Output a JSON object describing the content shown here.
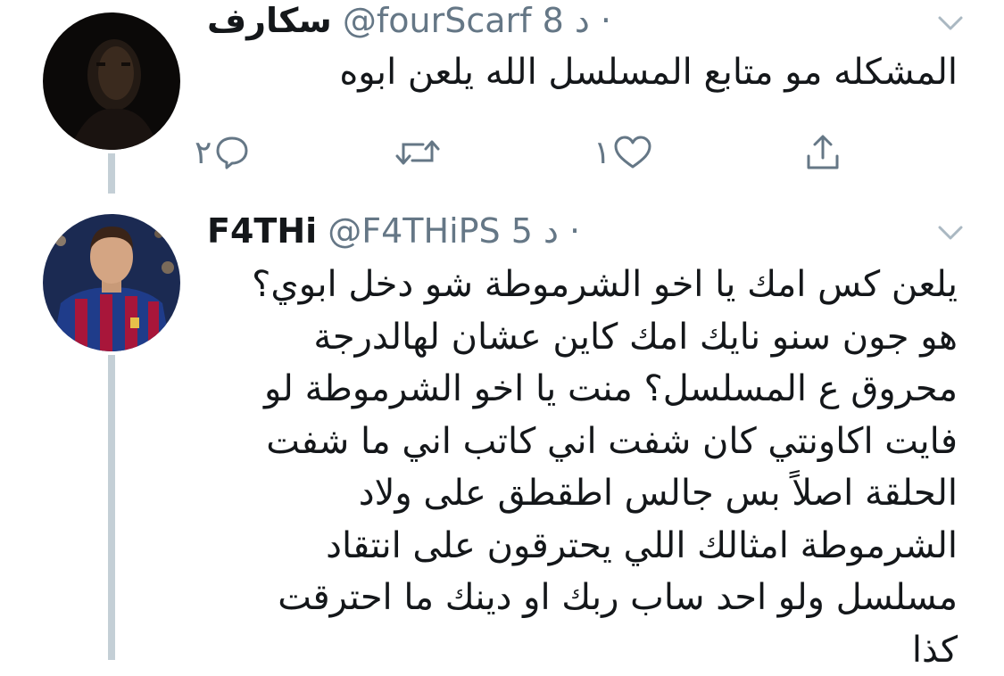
{
  "tweets": [
    {
      "name": "سكارف",
      "handle": "@fourScarf",
      "time": "8 د ·",
      "text_lines": [
        "المشكله مو متابع المسلسل الله يلعن ابوه"
      ],
      "actions": {
        "reply_count": "٢",
        "retweet_count": "",
        "like_count": "١"
      },
      "avatar_icon": "dark-portrait-avatar"
    },
    {
      "name": "F4THi",
      "handle": "@F4THiPS",
      "time": "5 د ·",
      "text_lines": [
        "يلعن كس امك يا اخو الشرموطة شو دخل ابوي؟",
        "هو جون سنو نايك امك كاين عشان لهالدرجة",
        "محروق ع المسلسل؟ منت يا اخو الشرموطة لو",
        "فايت اكاونتي كان شفت اني كاتب اني ما شفت",
        "الحلقة اصلاً بس جالس اطقطق على ولاد",
        "الشرموطة امثالك اللي يحترقون على انتقاد",
        "مسلسل ولو احد ساب ربك او دينك ما احترقت",
        "كذا"
      ],
      "avatar_icon": "football-player-avatar"
    }
  ],
  "colors": {
    "text": "#14171a",
    "secondary": "#657786",
    "thread_line": "#c4cfd6"
  }
}
